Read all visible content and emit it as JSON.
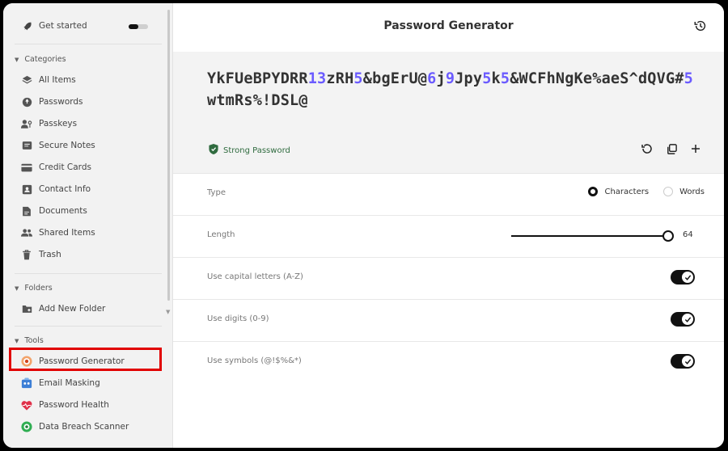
{
  "sidebar": {
    "get_started": "Get started",
    "categories_header": "Categories",
    "categories": [
      {
        "label": "All Items",
        "icon": "layers-icon"
      },
      {
        "label": "Passwords",
        "icon": "key-circle-icon"
      },
      {
        "label": "Passkeys",
        "icon": "passkey-icon"
      },
      {
        "label": "Secure Notes",
        "icon": "note-icon"
      },
      {
        "label": "Credit Cards",
        "icon": "credit-card-icon"
      },
      {
        "label": "Contact Info",
        "icon": "contact-icon"
      },
      {
        "label": "Documents",
        "icon": "document-icon"
      },
      {
        "label": "Shared Items",
        "icon": "users-icon"
      },
      {
        "label": "Trash",
        "icon": "trash-icon"
      }
    ],
    "folders_header": "Folders",
    "add_folder": "Add New Folder",
    "tools_header": "Tools",
    "tools": [
      {
        "label": "Password Generator",
        "icon": "password-generator-icon"
      },
      {
        "label": "Email Masking",
        "icon": "email-masking-icon"
      },
      {
        "label": "Password Health",
        "icon": "heart-pulse-icon"
      },
      {
        "label": "Data Breach Scanner",
        "icon": "scanner-icon"
      }
    ]
  },
  "main": {
    "title": "Password Generator",
    "password_segments": [
      {
        "t": "YkFUeBPYDRR",
        "d": false
      },
      {
        "t": "13",
        "d": true
      },
      {
        "t": "zRH",
        "d": false
      },
      {
        "t": "5",
        "d": true
      },
      {
        "t": "&bgErU@",
        "d": false
      },
      {
        "t": "6",
        "d": true
      },
      {
        "t": "j",
        "d": false
      },
      {
        "t": "9",
        "d": true
      },
      {
        "t": "Jpy",
        "d": false
      },
      {
        "t": "5",
        "d": true
      },
      {
        "t": "k",
        "d": false
      },
      {
        "t": "5",
        "d": true
      },
      {
        "t": "&WCFhNgKe%aeS^dQVG#",
        "d": false
      },
      {
        "t": "5",
        "d": true
      },
      {
        "t": "wtmRs%!DSL@",
        "d": false
      }
    ],
    "strength": "Strong Password",
    "type_label": "Type",
    "type_options": [
      "Characters",
      "Words"
    ],
    "type_selected": "Characters",
    "length_label": "Length",
    "length_value": "64",
    "options": [
      {
        "label": "Use capital letters (A-Z)",
        "on": true
      },
      {
        "label": "Use digits (0-9)",
        "on": true
      },
      {
        "label": "Use symbols (@!$%&*)",
        "on": true
      }
    ]
  },
  "colors": {
    "digit_accent": "#6b5bff",
    "strength_green": "#2f6b3f",
    "highlight_red": "#e10000"
  }
}
